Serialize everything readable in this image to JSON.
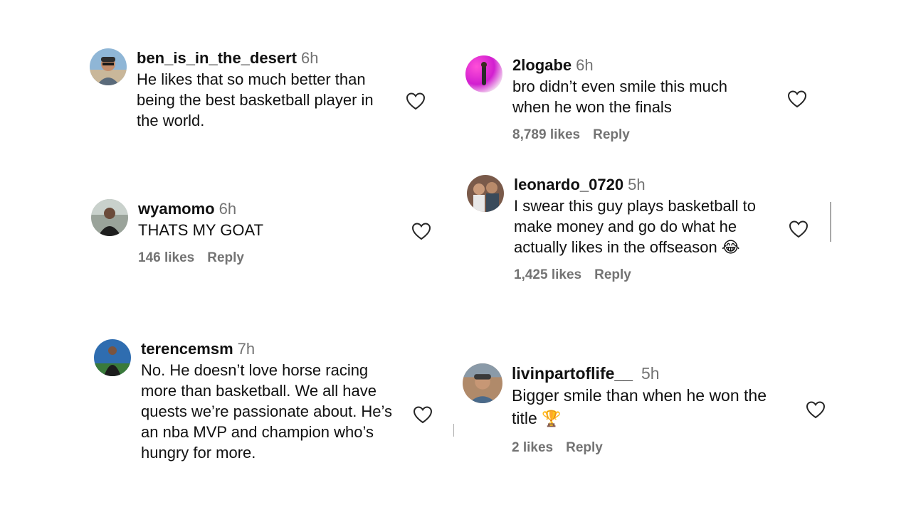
{
  "comments": [
    {
      "username": "ben_is_in_the_desert",
      "time": "6h",
      "text": "He likes that so much better than being the best basketball player in the world.",
      "likes": "",
      "reply": ""
    },
    {
      "username": "2logabe",
      "time": "6h",
      "text": "bro didn’t even smile this much when he won the finals",
      "likes": "8,789 likes",
      "reply": "Reply"
    },
    {
      "username": "wyamomo",
      "time": "6h",
      "text": "THATS MY GOAT",
      "likes": "146 likes",
      "reply": "Reply"
    },
    {
      "username": "leonardo_0720",
      "time": "5h",
      "text": "I swear this guy plays basketball to make money and go do what he actually likes in the offseason",
      "emoji": "😂",
      "likes": "1,425 likes",
      "reply": "Reply"
    },
    {
      "username": "terencemsm",
      "time": "7h",
      "text": "No. He doesn’t love horse racing more than basketball. We all have quests we’re passionate about. He’s an nba MVP and champion who’s hungry for more.",
      "likes": "",
      "reply": ""
    },
    {
      "username": "livinpartoflife__",
      "time": "5h",
      "text": "Bigger smile than when he won the title",
      "emoji": "🏆",
      "likes": "2 likes",
      "reply": "Reply"
    }
  ],
  "icons": {
    "like": "heart-outline-icon",
    "avatar": "profile-picture"
  },
  "colors": {
    "text": "#111111",
    "muted": "#737373"
  }
}
